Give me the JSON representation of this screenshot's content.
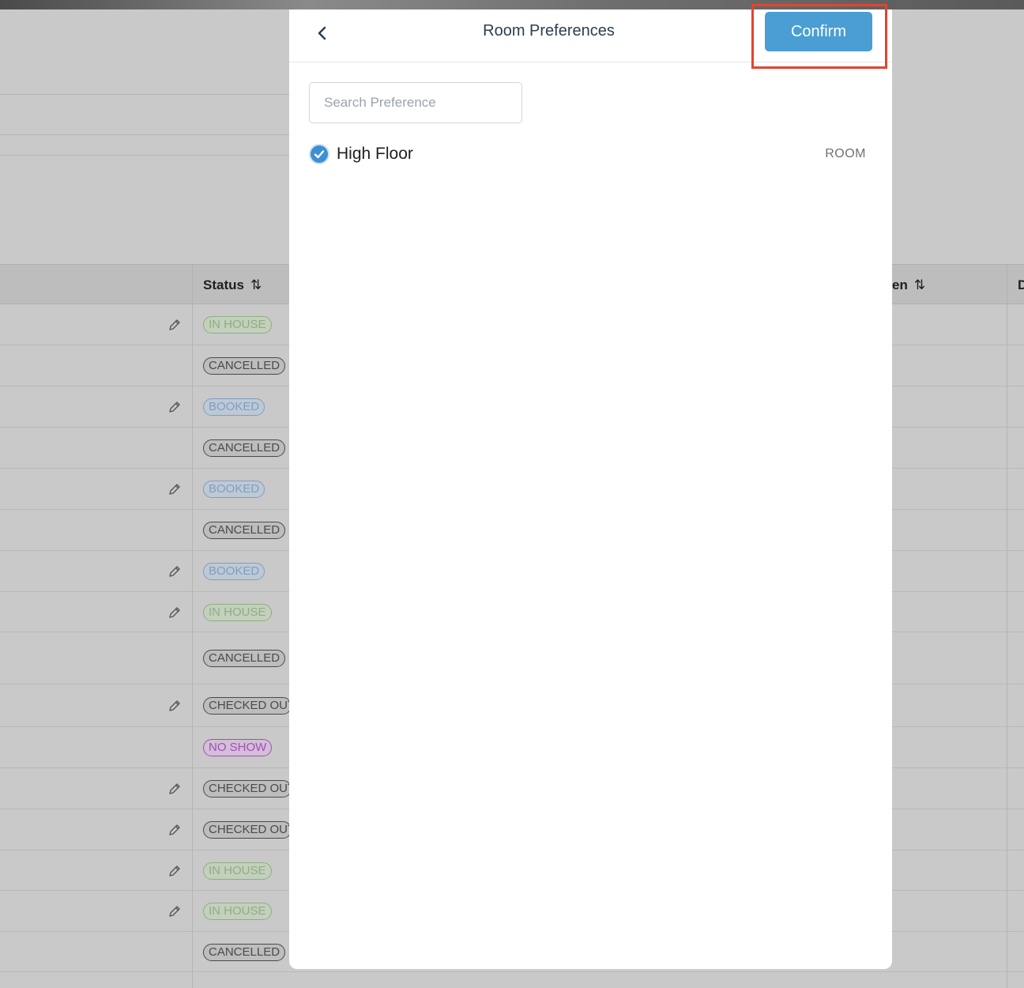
{
  "modal": {
    "title": "Room Preferences",
    "confirm_label": "Confirm",
    "search": {
      "placeholder": "Search Preference",
      "value": ""
    },
    "preferences": [
      {
        "label": "High Floor",
        "category": "ROOM",
        "checked": true
      }
    ]
  },
  "table": {
    "headers": {
      "status": "Status",
      "partial_right": "en",
      "partial_far": "D"
    },
    "rows": [
      {
        "status": "IN HOUSE",
        "kind": "inhouse",
        "editable": true
      },
      {
        "status": "CANCELLED",
        "kind": "cancelled",
        "editable": false
      },
      {
        "status": "BOOKED",
        "kind": "booked",
        "editable": true
      },
      {
        "status": "CANCELLED",
        "kind": "cancelled",
        "editable": false
      },
      {
        "status": "BOOKED",
        "kind": "booked",
        "editable": true
      },
      {
        "status": "CANCELLED",
        "kind": "cancelled",
        "editable": false
      },
      {
        "status": "BOOKED",
        "kind": "booked",
        "editable": true
      },
      {
        "status": "IN HOUSE",
        "kind": "inhouse",
        "editable": true
      },
      {
        "status": "CANCELLED",
        "kind": "cancelled",
        "editable": false
      },
      {
        "status": "CHECKED OUT",
        "kind": "checkedout",
        "editable": true
      },
      {
        "status": "NO SHOW",
        "kind": "noshow",
        "editable": false
      },
      {
        "status": "CHECKED OUT",
        "kind": "checkedout",
        "editable": true
      },
      {
        "status": "CHECKED OUT",
        "kind": "checkedout",
        "editable": true
      },
      {
        "status": "IN HOUSE",
        "kind": "inhouse",
        "editable": true
      },
      {
        "status": "IN HOUSE",
        "kind": "inhouse",
        "editable": true
      },
      {
        "status": "CANCELLED",
        "kind": "cancelled",
        "editable": false
      }
    ]
  },
  "colors": {
    "accent": "#4a9ed3",
    "highlight": "#e2452f",
    "checkbox": "#3d8fd1"
  }
}
